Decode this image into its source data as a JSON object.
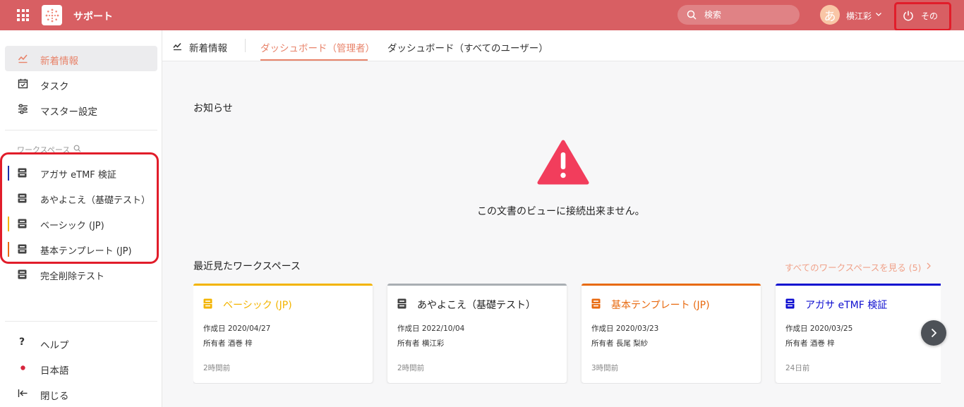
{
  "header": {
    "app_title": "サポート",
    "search_placeholder": "検索",
    "avatar_char": "あ",
    "user_name": "横江彩",
    "power_label": "その"
  },
  "sidebar": {
    "main_items": [
      {
        "label": "新着情報",
        "icon": "chart-line-icon",
        "active": true
      },
      {
        "label": "タスク",
        "icon": "calendar-check-icon"
      },
      {
        "label": "マスター設定",
        "icon": "sliders-icon"
      }
    ],
    "workspace_heading": "ワークスペース",
    "workspaces": [
      {
        "label": "アガサ eTMF 検証",
        "color": "#1a2ea8"
      },
      {
        "label": "あやよこえ（基礎テスト）",
        "color": ""
      },
      {
        "label": "ベーシック (JP)",
        "color": "#f3b400"
      },
      {
        "label": "基本テンプレート (JP)",
        "color": "#e86a10"
      },
      {
        "label": "完全削除テスト",
        "color": ""
      }
    ],
    "footer_items": [
      {
        "label": "ヘルプ",
        "icon": "question-icon"
      },
      {
        "label": "日本語",
        "icon": "japan-flag-icon"
      },
      {
        "label": "閉じる",
        "icon": "collapse-left-icon"
      }
    ]
  },
  "tabs": {
    "home_label": "新着情報",
    "items": [
      "ダッシュボード（管理者）",
      "ダッシュボード（すべてのユーザー）"
    ]
  },
  "main": {
    "notice_title": "お知らせ",
    "notice_message": "この文書のビューに接続出来ません。",
    "recent_title": "最近見たワークスペース",
    "see_all": "すべてのワークスペースを見る (5)",
    "cards": [
      {
        "name": "ベーシック (JP)",
        "color": "#f3b400",
        "created": "作成日 2020/04/27",
        "owner": "所有者 酒巻 梓",
        "ago": "2時間前"
      },
      {
        "name": "あやよこえ（基礎テスト）",
        "color": "#a9aeb3",
        "created": "作成日 2022/10/04",
        "owner": "所有者 横江彩",
        "ago": "2時間前"
      },
      {
        "name": "基本テンプレート (JP)",
        "color": "#e86a10",
        "created": "作成日 2020/03/23",
        "owner": "所有者 長尾 梨紗",
        "ago": "3時間前"
      },
      {
        "name": "アガサ eTMF 検証",
        "color": "#1010d0",
        "created": "作成日 2020/03/25",
        "owner": "所有者 酒巻 梓",
        "ago": "24日前"
      }
    ]
  },
  "colors": {
    "header_bg": "#d85f63",
    "accent": "#e8836a",
    "warning": "#f23d5c",
    "highlight_outline": "#e11d2a"
  }
}
